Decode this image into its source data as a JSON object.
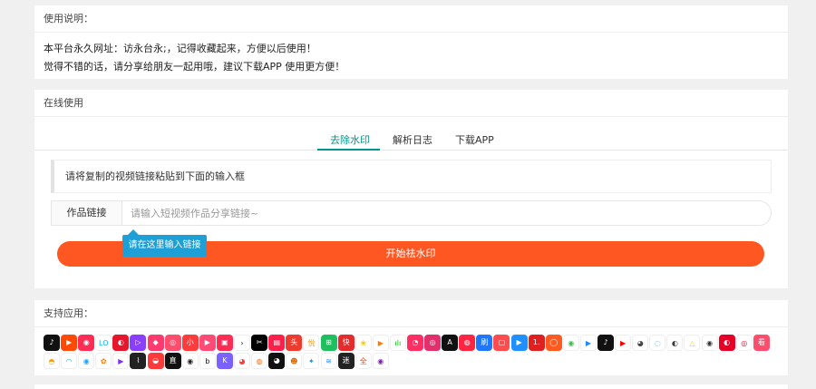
{
  "usage": {
    "title": "使用说明：",
    "line1": "本平台永久网址：访永台永;，记得收藏起来，方便以后使用！",
    "line2": "觉得不错的话，请分享给朋友一起用哦，建议下载APP 使用更方便！"
  },
  "online": {
    "title": "在线使用",
    "tabs": [
      {
        "label": "去除水印",
        "active": true
      },
      {
        "label": "解析日志",
        "active": false
      },
      {
        "label": "下载APP",
        "active": false
      }
    ],
    "notice": "请将复制的视频链接粘贴到下面的输入框",
    "input_label": "作品链接",
    "input_placeholder": "请输入短视频作品分享链接~",
    "tooltip": "请在这里输入链接",
    "start_button": "开始祛水印"
  },
  "apps": {
    "title": "支持应用：",
    "icons": [
      {
        "name": "douyin-icon",
        "color": "#111111",
        "glyph": "♪"
      },
      {
        "name": "kuaishou-icon",
        "color": "#ff4906",
        "glyph": "▶"
      },
      {
        "name": "huoshan-icon",
        "color": "#ff2c55",
        "glyph": "◉"
      },
      {
        "name": "lofter-icon",
        "color": "#ffffff",
        "glyph": "LO",
        "fg": "#00b2ff"
      },
      {
        "name": "weibo-icon",
        "color": "#e6162d",
        "glyph": "◐"
      },
      {
        "name": "weishi-icon",
        "color": "#8a3ffc",
        "glyph": "▷"
      },
      {
        "name": "meipai-icon",
        "color": "#ff3a6e",
        "glyph": "◆"
      },
      {
        "name": "pipixia-icon",
        "color": "#ff4d6d",
        "glyph": "◎"
      },
      {
        "name": "xiaokaxiu-icon",
        "color": "#ff3b3b",
        "glyph": "小"
      },
      {
        "name": "bilibili-icon",
        "color": "#ff4b75",
        "glyph": "▶"
      },
      {
        "name": "vigo-icon",
        "color": "#ff2d55",
        "glyph": "▣"
      },
      {
        "name": "capcut-icon",
        "color": "#ffffff",
        "glyph": "›",
        "fg": "#111111"
      },
      {
        "name": "jianying-icon",
        "color": "#000000",
        "glyph": "✂"
      },
      {
        "name": "kugou-icon",
        "color": "#ff1f4b",
        "glyph": "▤"
      },
      {
        "name": "toutiao-icon",
        "color": "#ed3b2e",
        "glyph": "头"
      },
      {
        "name": "haokan-icon",
        "color": "#ffffff",
        "glyph": "悦",
        "fg": "#ff9a00"
      },
      {
        "name": "quanmin-icon",
        "color": "#1fbf5f",
        "glyph": "⊞"
      },
      {
        "name": "kuaibao-icon",
        "color": "#e52b2b",
        "glyph": "快"
      },
      {
        "name": "maoyan-icon",
        "color": "#ffffff",
        "glyph": "❀",
        "fg": "#f5c400"
      },
      {
        "name": "tencent-video-icon",
        "color": "#ffffff",
        "glyph": "▶",
        "fg": "#ff7b00"
      },
      {
        "name": "iqiyi-icon",
        "color": "#ffffff",
        "glyph": "ılı",
        "fg": "#00be06"
      },
      {
        "name": "momo-icon",
        "color": "#ff2e63",
        "glyph": "◔"
      },
      {
        "name": "instagram-icon",
        "color": "#e1306c",
        "glyph": "◎"
      },
      {
        "name": "acfun-icon",
        "color": "#111111",
        "glyph": "A"
      },
      {
        "name": "xhs-icon",
        "color": "#ff2442",
        "glyph": "◍"
      },
      {
        "name": "zuiyou-icon",
        "color": "#2176ff",
        "glyph": "刷"
      },
      {
        "name": "shuabao-icon",
        "color": "#ff4d4f",
        "glyph": "▢"
      },
      {
        "name": "lvzhou-icon",
        "color": "#1e90ff",
        "glyph": "▶"
      },
      {
        "name": "yixia-icon",
        "color": "#e02020",
        "glyph": "1."
      },
      {
        "name": "miaopai-icon",
        "color": "#ff5a1f",
        "glyph": "◯"
      },
      {
        "name": "weishi2-icon",
        "color": "#ffffff",
        "glyph": "◉",
        "fg": "#3cba54"
      },
      {
        "name": "youku-icon",
        "color": "#ffffff",
        "glyph": "▶",
        "fg": "#1d8cff"
      },
      {
        "name": "tiktok-icon",
        "color": "#111111",
        "glyph": "♪"
      },
      {
        "name": "youtube-icon",
        "color": "#ffffff",
        "glyph": "▶",
        "fg": "#ff0000"
      },
      {
        "name": "twitch-icon",
        "color": "#ffffff",
        "glyph": "◕",
        "fg": "#444444"
      },
      {
        "name": "qq-icon",
        "color": "#ffffff",
        "glyph": "◌",
        "fg": "#1aa2ff"
      },
      {
        "name": "miniprog-icon",
        "color": "#ffffff",
        "glyph": "◐",
        "fg": "#3a3a3a"
      },
      {
        "name": "haokan2-icon",
        "color": "#ffffff",
        "glyph": "△",
        "fg": "#f7c21b"
      },
      {
        "name": "camera-icon",
        "color": "#ffffff",
        "glyph": "◉",
        "fg": "#333333"
      },
      {
        "name": "wangyi-icon",
        "color": "#e60026",
        "glyph": "◐"
      },
      {
        "name": "netease-music-icon",
        "color": "#ffffff",
        "glyph": "◎",
        "fg": "#e60026"
      },
      {
        "name": "kankan-icon",
        "color": "#ff4d6d",
        "glyph": "看"
      },
      {
        "name": "huya-icon",
        "color": "#ffffff",
        "glyph": "◓",
        "fg": "#f7a11a"
      },
      {
        "name": "douyu-icon",
        "color": "#ffffff",
        "glyph": "◠",
        "fg": "#26a69a"
      },
      {
        "name": "qq-penguin-icon",
        "color": "#ffffff",
        "glyph": "◉",
        "fg": "#1aa2ff"
      }
    ],
    "icons_row2": [
      {
        "name": "taobao-icon",
        "color": "#ffffff",
        "glyph": "✿",
        "fg": "#ff7a00"
      },
      {
        "name": "vmate-icon",
        "color": "#ffffff",
        "glyph": "▶",
        "fg": "#7b2ff7"
      },
      {
        "name": "shortvideo-icon",
        "color": "#222222",
        "glyph": "⌇"
      },
      {
        "name": "yy-icon",
        "color": "#ff3a3a",
        "glyph": "◒"
      },
      {
        "name": "zhibo-icon",
        "color": "#111111",
        "glyph": "直"
      },
      {
        "name": "xigua-icon",
        "color": "#ffffff",
        "glyph": "◉",
        "fg": "#222222"
      },
      {
        "name": "b-icon",
        "color": "#ffffff",
        "glyph": "b",
        "fg": "#111111"
      },
      {
        "name": "k-icon",
        "color": "#7b61ff",
        "glyph": "K"
      },
      {
        "name": "red-icon",
        "color": "#ffffff",
        "glyph": "◕",
        "fg": "#ff3a3a"
      },
      {
        "name": "photo-icon",
        "color": "#ffffff",
        "glyph": "◍",
        "fg": "#ff6a00"
      },
      {
        "name": "face-icon",
        "color": "#111111",
        "glyph": "◕"
      },
      {
        "name": "monkey-icon",
        "color": "#ffffff",
        "glyph": "☻",
        "fg": "#d46b08"
      },
      {
        "name": "bird-icon",
        "color": "#ffffff",
        "glyph": "✦",
        "fg": "#1890ff"
      },
      {
        "name": "stack-icon",
        "color": "#ffffff",
        "glyph": "≋",
        "fg": "#2d8cf0"
      },
      {
        "name": "jianyue-icon",
        "color": "#222222",
        "glyph": "迷"
      },
      {
        "name": "quan-icon",
        "color": "#ffffff",
        "glyph": "全",
        "fg": "#e64a19"
      },
      {
        "name": "circle-icon",
        "color": "#ffffff",
        "glyph": "◉",
        "fg": "#7b1fa2"
      }
    ]
  }
}
